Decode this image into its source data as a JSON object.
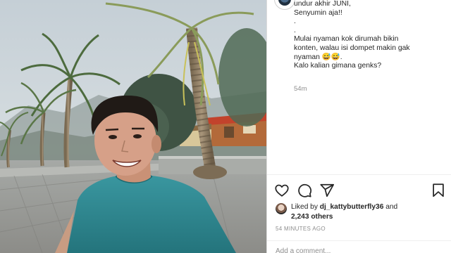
{
  "post": {
    "caption_lines": [
      "undur akhir JUNI,",
      "Senyumin aja!!",
      ".",
      ".",
      "Mulai nyaman kok dirumah bikin",
      "konten, walau isi dompet makin gak",
      "nyaman 😅😅.",
      "Kalo kalian gimana genks?"
    ],
    "caption_time": "54m",
    "liked_by_prefix": "Liked by ",
    "liked_by_user": "dj_kattybutterfly36",
    "liked_by_and": " and",
    "others": "2,243 others",
    "timestamp": "54 MINUTES AGO",
    "comment_placeholder": "Add a comment..."
  },
  "icons": {
    "like": "heart-icon",
    "comment": "comment-bubble-icon",
    "share": "paper-plane-icon",
    "save": "bookmark-icon"
  },
  "colors": {
    "text": "#262626",
    "muted": "#8e8e8e",
    "divider": "#dbdbdb",
    "shirt": "#2f8a91"
  }
}
